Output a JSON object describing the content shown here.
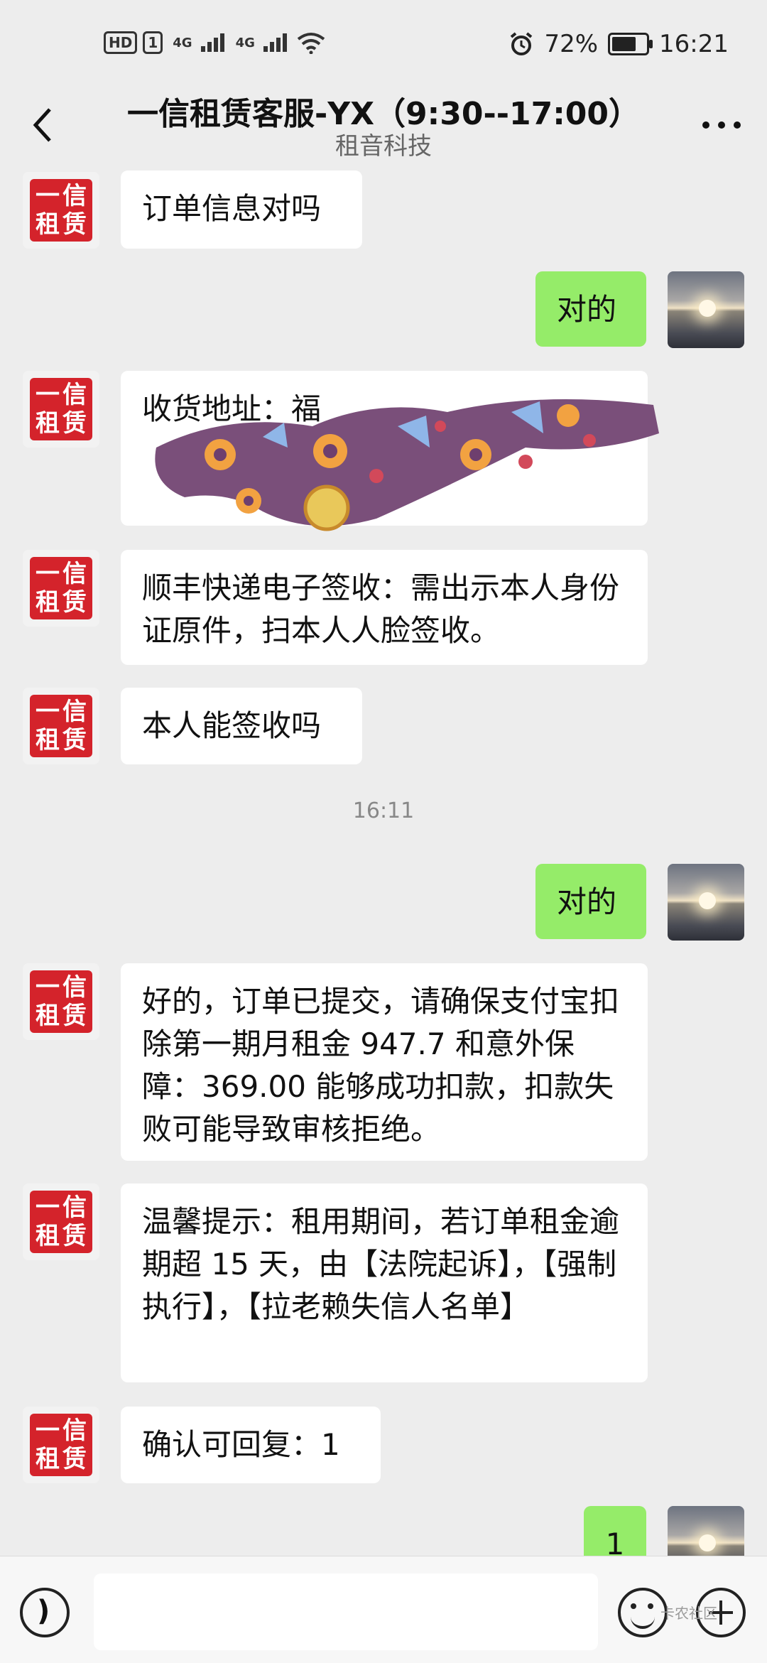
{
  "status_bar": {
    "hd": "HD",
    "sim": "1",
    "net1": "4G",
    "net2": "4G",
    "battery_pct": "72%",
    "battery_level": 0.72,
    "time": "16:21"
  },
  "header": {
    "title": "一信租赁客服-YX（9:30--17:00）",
    "subtitle": "租音科技"
  },
  "avatar_text": [
    "一",
    "信",
    "租",
    "赁"
  ],
  "messages": [
    {
      "dir": "in",
      "text": "订单信息对吗"
    },
    {
      "dir": "out",
      "text": "对的"
    },
    {
      "dir": "in",
      "text": "收货地址：福"
    },
    {
      "dir": "in",
      "text": "顺丰快递电子签收：需出示本人身份证原件，扫本人人脸签收。"
    },
    {
      "dir": "in",
      "text": "本人能签收吗"
    },
    {
      "dir": "time",
      "text": "16:11"
    },
    {
      "dir": "out",
      "text": "对的"
    },
    {
      "dir": "in",
      "text": "好的，订单已提交，请确保支付宝扣除第一期月租金 947.7 和意外保障：369.00 能够成功扣款，扣款失败可能导致审核拒绝。"
    },
    {
      "dir": "in",
      "text": "温馨提示：租用期间，若订单租金逾期超 15 天，由【法院起诉】，【强制执行】，【拉老赖失信人名单】"
    },
    {
      "dir": "in",
      "text": "确认可回复：1"
    },
    {
      "dir": "out",
      "text": "1"
    }
  ],
  "bottom_bar": {
    "watermark": "卡农社区"
  }
}
